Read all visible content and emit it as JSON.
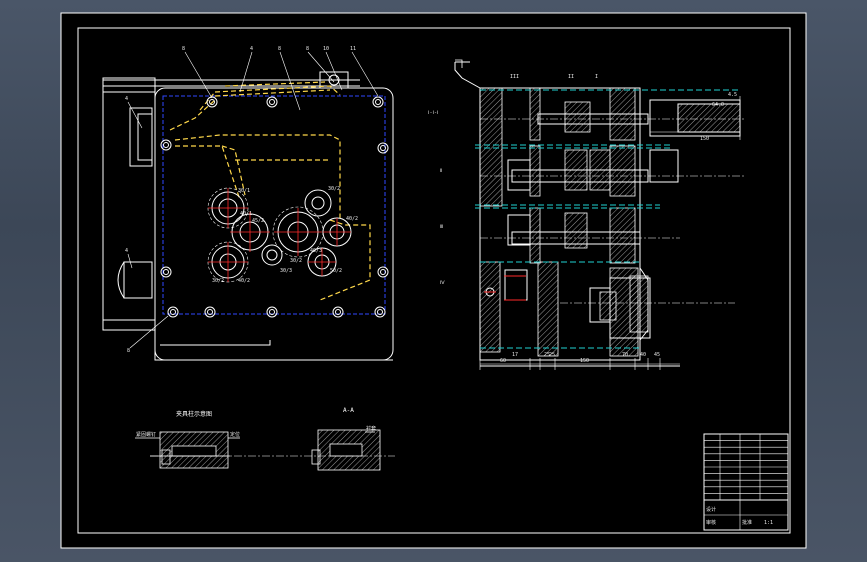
{
  "app": {
    "title": "",
    "background": "#3b4656",
    "sheet_color": "#000000"
  },
  "colors": {
    "line": "#ffffff",
    "blue_dashed": "#3048ff",
    "yellow_dashed": "#ffd84a",
    "cyan_dashed": "#1fd2d2",
    "red_center": "#ff2a2a",
    "hatch": "#ffffff",
    "dim_text": "#e8e8e8"
  },
  "front_view": {
    "leader_numbers": [
      "8",
      "4",
      "8",
      "8",
      "10",
      "11",
      "4",
      "4",
      "8"
    ],
    "gear_labels": [
      "30/1",
      "30/2",
      "40/1",
      "45/2",
      "40/2",
      "30/2",
      "30/3",
      "50/2",
      "30/2",
      "40/2",
      "40/3"
    ]
  },
  "side_view": {
    "section_marks": [
      "III",
      "II",
      "I"
    ],
    "side_notes": [
      "Ⅰ-Ⅰ-Ⅰ",
      "Ⅱ",
      "Ⅲ",
      "Ⅳ"
    ],
    "bottom_dims": [
      "60",
      "17",
      "25",
      "25",
      "150",
      "70",
      "40",
      "45"
    ],
    "top_dims": [
      "150",
      "64.0",
      "4.5"
    ]
  },
  "detail_views": {
    "left_title": "夹具柱示意图",
    "right_title": "A-A",
    "left_callout": "紧固螺钉",
    "left_callout2": "定位",
    "right_callout": "衬套"
  },
  "title_block": {
    "rows": 10,
    "footer_cells": [
      "设计",
      "审核",
      "批准",
      "1:1"
    ]
  },
  "icons": [
    "chevron-corner-icon"
  ]
}
